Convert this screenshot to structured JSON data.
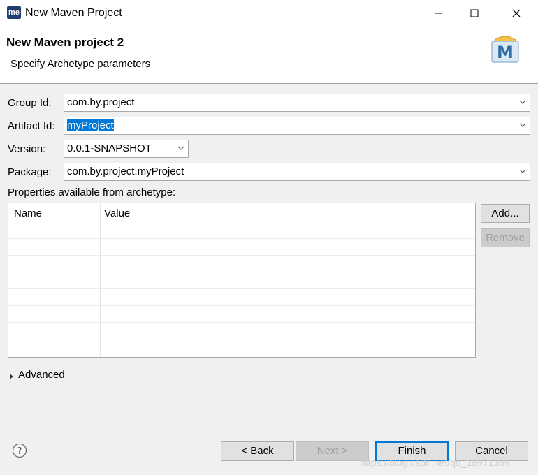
{
  "window": {
    "title": "New Maven Project",
    "app_icon_text": "me"
  },
  "header": {
    "title": "New Maven project 2",
    "description": "Specify Archetype parameters",
    "logo_letter": "M"
  },
  "form": {
    "group_id_label": "Group Id:",
    "group_id_value": "com.by.project",
    "artifact_id_label": "Artifact Id:",
    "artifact_id_value": "myProject",
    "version_label": "Version:",
    "version_value": "0.0.1-SNAPSHOT",
    "package_label": "Package:",
    "package_value": "com.by.project.myProject"
  },
  "properties": {
    "label": "Properties available from archetype:",
    "columns": [
      "Name",
      "Value"
    ],
    "add_label": "Add...",
    "remove_label": "Remove"
  },
  "advanced": {
    "label": "Advanced"
  },
  "footer": {
    "back_label": "< Back",
    "next_label": "Next >",
    "finish_label": "Finish",
    "cancel_label": "Cancel",
    "help_icon_text": "?"
  },
  "watermark": "https://blog.csdn.net/qq_18971389",
  "colors": {
    "selection": "#0078d7",
    "logo_blue": "#2f6ea8"
  }
}
